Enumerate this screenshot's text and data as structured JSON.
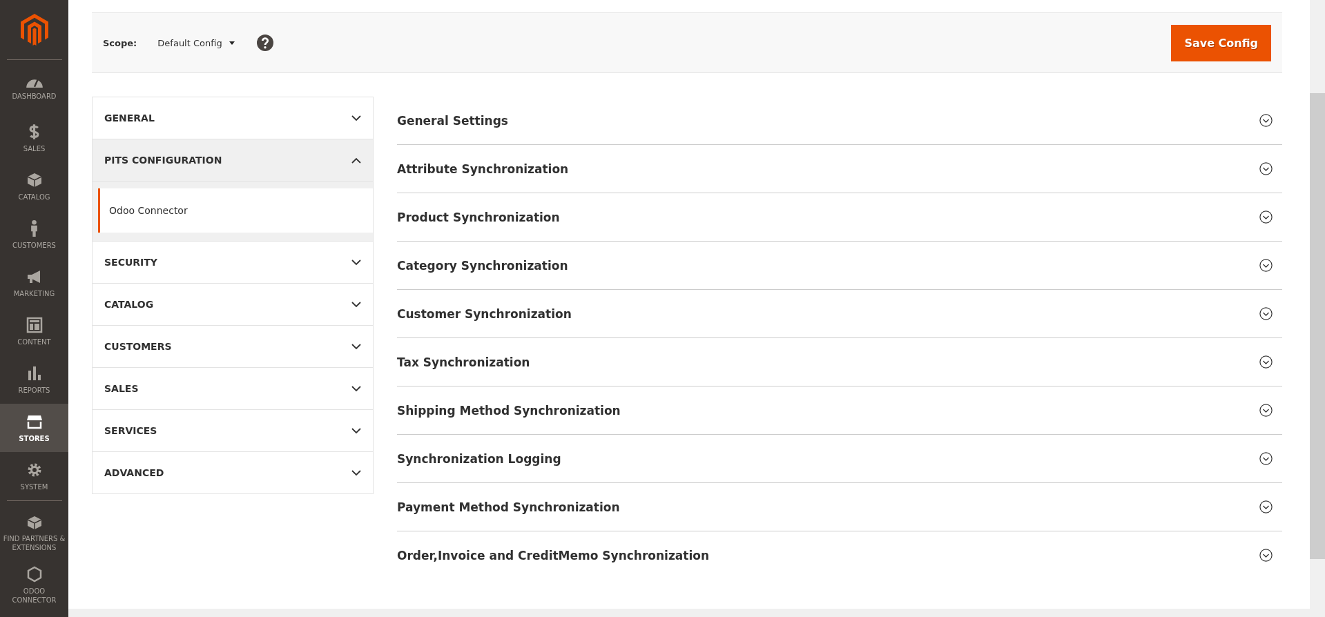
{
  "nav": [
    {
      "kind": "dashboard",
      "label": "DASHBOARD",
      "selected": false
    },
    {
      "kind": "sales",
      "label": "SALES",
      "selected": false
    },
    {
      "kind": "catalog",
      "label": "CATALOG",
      "selected": false
    },
    {
      "kind": "customers",
      "label": "CUSTOMERS",
      "selected": false
    },
    {
      "kind": "marketing",
      "label": "MARKETING",
      "selected": false
    },
    {
      "kind": "content",
      "label": "CONTENT",
      "selected": false
    },
    {
      "kind": "reports",
      "label": "REPORTS",
      "selected": false
    },
    {
      "kind": "stores",
      "label": "STORES",
      "selected": true
    },
    {
      "kind": "system",
      "label": "SYSTEM",
      "selected": false
    },
    {
      "kind": "partners",
      "label": "FIND PARTNERS & EXTENSIONS",
      "selected": false
    },
    {
      "kind": "odoo",
      "label": "ODOO CONNECTOR",
      "selected": false
    }
  ],
  "toolbar": {
    "scope_label": "Scope:",
    "scope_value": "Default Config",
    "save_button": "Save Config"
  },
  "config_tabs": [
    {
      "label": "GENERAL",
      "expanded": false
    },
    {
      "label": "PITS CONFIGURATION",
      "expanded": true,
      "children": [
        {
          "label": "Odoo Connector",
          "selected": true
        }
      ]
    },
    {
      "label": "SECURITY",
      "expanded": false
    },
    {
      "label": "CATALOG",
      "expanded": false
    },
    {
      "label": "CUSTOMERS",
      "expanded": false
    },
    {
      "label": "SALES",
      "expanded": false
    },
    {
      "label": "SERVICES",
      "expanded": false
    },
    {
      "label": "ADVANCED",
      "expanded": false
    }
  ],
  "sections": [
    {
      "title": "General Settings"
    },
    {
      "title": "Attribute Synchronization"
    },
    {
      "title": "Product Synchronization"
    },
    {
      "title": "Category Synchronization"
    },
    {
      "title": "Customer Synchronization"
    },
    {
      "title": "Tax Synchronization"
    },
    {
      "title": "Shipping Method Synchronization"
    },
    {
      "title": "Synchronization Logging"
    },
    {
      "title": "Payment Method Synchronization"
    },
    {
      "title": "Order,Invoice and CreditMemo Synchronization"
    }
  ]
}
